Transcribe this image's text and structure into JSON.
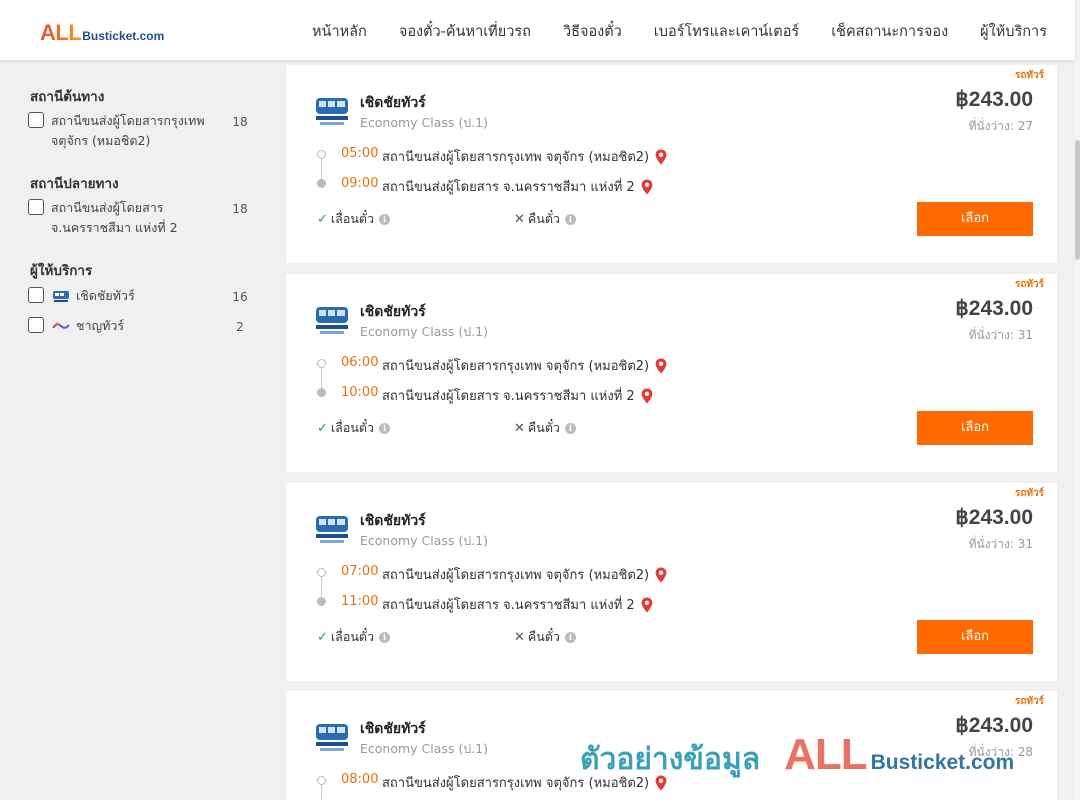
{
  "header": {
    "logo_all": "ALL",
    "logo_suffix": "Busticket.com",
    "nav": [
      "หน้าหลัก",
      "จองตั๋ว-ค้นหาเที่ยวรถ",
      "วิธีจองตั๋ว",
      "เบอร์โทรและเคาน์เตอร์",
      "เช็คสถานะการจอง",
      "ผู้ให้บริการ"
    ]
  },
  "sidebar": {
    "origin": {
      "title": "สถานีต้นทาง",
      "items": [
        {
          "label": "สถานีขนส่งผู้โดยสารกรุงเทพ จตุจักร (หมอชิต2)",
          "count": "18"
        }
      ]
    },
    "destination": {
      "title": "สถานีปลายทาง",
      "items": [
        {
          "label": "สถานีขนส่งผู้โดยสาร จ.นครราชสีมา แห่งที่ 2",
          "count": "18"
        }
      ]
    },
    "operators": {
      "title": "ผู้ให้บริการ",
      "items": [
        {
          "label": "เชิดชัยทัวร์",
          "count": "16"
        },
        {
          "label": "ชาญทัวร์",
          "count": "2"
        }
      ]
    }
  },
  "trips": [
    {
      "tag": "รถทัวร์",
      "operator": "เชิดชัยทัวร์",
      "class": "Economy Class (ป.1)",
      "price": "฿243.00",
      "seats": "ที่นั่งว่าง: 27",
      "depart_time": "05:00",
      "depart_station": "สถานีขนส่งผู้โดยสารกรุงเทพ จตุจักร (หมอชิต2)",
      "arrive_time": "09:00",
      "arrive_station": "สถานีขนส่งผู้โดยสาร จ.นครราชสีมา แห่งที่ 2",
      "reschedule": "เลื่อนตั๋ว",
      "refund": "คืนตั๋ว",
      "select": "เลือก"
    },
    {
      "tag": "รถทัวร์",
      "operator": "เชิดชัยทัวร์",
      "class": "Economy Class (ป.1)",
      "price": "฿243.00",
      "seats": "ที่นั่งว่าง: 31",
      "depart_time": "06:00",
      "depart_station": "สถานีขนส่งผู้โดยสารกรุงเทพ จตุจักร (หมอชิต2)",
      "arrive_time": "10:00",
      "arrive_station": "สถานีขนส่งผู้โดยสาร จ.นครราชสีมา แห่งที่ 2",
      "reschedule": "เลื่อนตั๋ว",
      "refund": "คืนตั๋ว",
      "select": "เลือก"
    },
    {
      "tag": "รถทัวร์",
      "operator": "เชิดชัยทัวร์",
      "class": "Economy Class (ป.1)",
      "price": "฿243.00",
      "seats": "ที่นั่งว่าง: 31",
      "depart_time": "07:00",
      "depart_station": "สถานีขนส่งผู้โดยสารกรุงเทพ จตุจักร (หมอชิต2)",
      "arrive_time": "11:00",
      "arrive_station": "สถานีขนส่งผู้โดยสาร จ.นครราชสีมา แห่งที่ 2",
      "reschedule": "เลื่อนตั๋ว",
      "refund": "คืนตั๋ว",
      "select": "เลือก"
    },
    {
      "tag": "รถทัวร์",
      "operator": "เชิดชัยทัวร์",
      "class": "Economy Class (ป.1)",
      "price": "฿243.00",
      "seats": "ที่นั่งว่าง: 28",
      "depart_time": "08:00",
      "depart_station": "สถานีขนส่งผู้โดยสารกรุงเทพ จตุจักร (หมอชิต2)"
    }
  ],
  "watermark": {
    "text": "ตัวอย่างข้อมูล",
    "all": "ALL",
    "suffix": "Busticket.com"
  },
  "colors": {
    "accent": "#ff6a00",
    "time": "#e8720c",
    "check": "#2a9d3a"
  }
}
